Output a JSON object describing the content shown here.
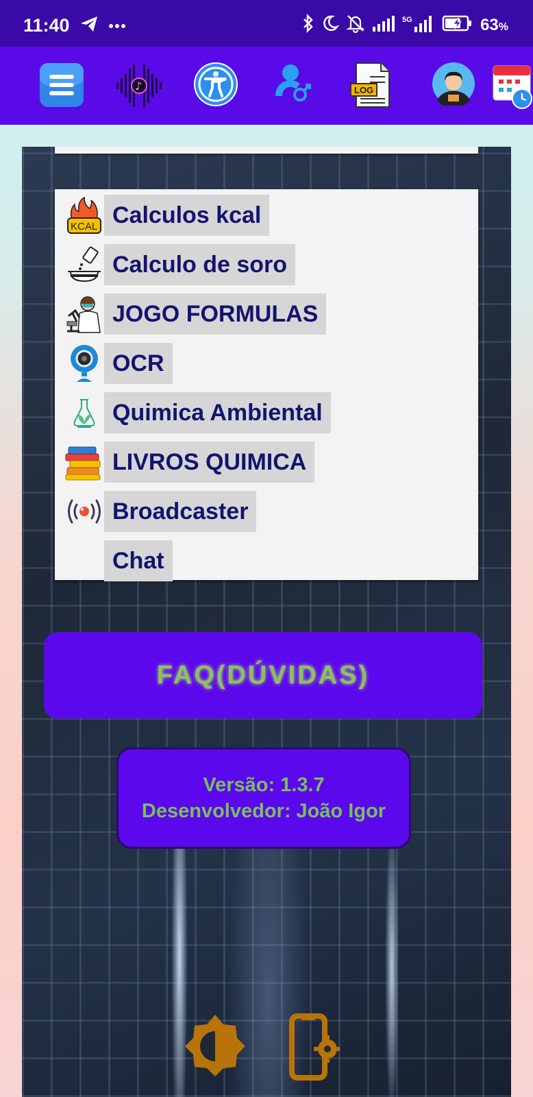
{
  "status_bar": {
    "time": "11:40",
    "battery_percent": "63",
    "battery_suffix": "%",
    "icons": [
      "telegram-icon",
      "more-dots-icon",
      "bluetooth-icon",
      "moon-icon",
      "bell-off-icon",
      "signal-icon",
      "5g-signal-icon",
      "battery-charging-icon"
    ]
  },
  "toolbar": {
    "icons": [
      "menu-icon",
      "music-wave-icon",
      "accessibility-icon",
      "user-gender-icon",
      "log-file-icon",
      "avatar",
      "calendar-clock-icon"
    ],
    "log_label": "LOG"
  },
  "menu": {
    "items": [
      {
        "label": "Calculos kcal",
        "icon": "kcal-fire-icon",
        "icon_text": "KCAL"
      },
      {
        "label": "Calculo de soro",
        "icon": "serum-bottle-icon"
      },
      {
        "label": "JOGO FORMULAS",
        "icon": "scientist-microscope-icon"
      },
      {
        "label": "OCR",
        "icon": "webcam-icon"
      },
      {
        "label": "Quimica Ambiental",
        "icon": "eco-flask-icon"
      },
      {
        "label": "LIVROS QUIMICA",
        "icon": "books-icon"
      },
      {
        "label": "Broadcaster",
        "icon": "broadcast-icon"
      },
      {
        "label": "Chat",
        "icon": ""
      }
    ]
  },
  "faq": {
    "label": "FAQ(DÚVIDAS)"
  },
  "info": {
    "version": "Versão: 1.3.7",
    "developer": "Desenvolvedor: João Igor"
  },
  "colors": {
    "status_bar": "#3a0aa8",
    "toolbar": "#5a0ae6",
    "button": "#5c08ec",
    "menu_text": "#121470",
    "faq_text": "#8bc25a",
    "info_text": "#79c05c"
  },
  "bottom_icons": [
    "brightness-icon",
    "phone-settings-icon"
  ]
}
